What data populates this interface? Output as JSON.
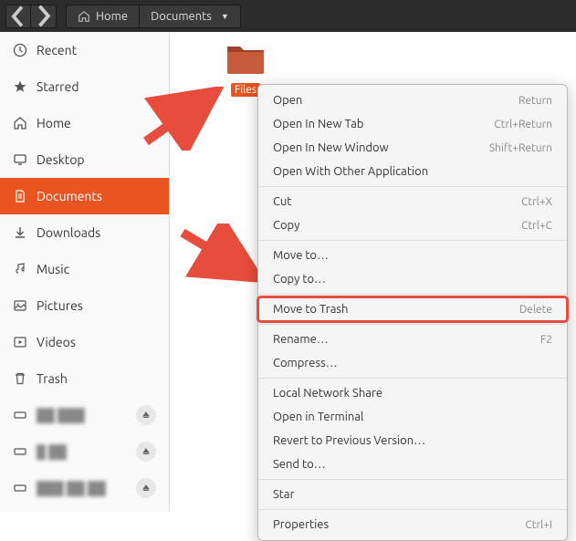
{
  "topbar": {
    "home_label": "Home",
    "current_label": "Documents"
  },
  "sidebar": {
    "items": [
      {
        "icon": "clock",
        "label": "Recent"
      },
      {
        "icon": "star",
        "label": "Starred"
      },
      {
        "icon": "home",
        "label": "Home"
      },
      {
        "icon": "desktop",
        "label": "Desktop"
      },
      {
        "icon": "documents",
        "label": "Documents"
      },
      {
        "icon": "downloads",
        "label": "Downloads"
      },
      {
        "icon": "music",
        "label": "Music"
      },
      {
        "icon": "pictures",
        "label": "Pictures"
      },
      {
        "icon": "videos",
        "label": "Videos"
      },
      {
        "icon": "trash",
        "label": "Trash"
      }
    ]
  },
  "folder": {
    "name": "Files"
  },
  "context_menu": [
    {
      "label": "Open",
      "shortcut": "Return"
    },
    {
      "label": "Open In New Tab",
      "shortcut": "Ctrl+Return"
    },
    {
      "label": "Open In New Window",
      "shortcut": "Shift+Return"
    },
    {
      "label": "Open With Other Application",
      "shortcut": ""
    },
    {
      "sep": true
    },
    {
      "label": "Cut",
      "shortcut": "Ctrl+X"
    },
    {
      "label": "Copy",
      "shortcut": "Ctrl+C"
    },
    {
      "sep": true
    },
    {
      "label": "Move to…",
      "shortcut": ""
    },
    {
      "label": "Copy to…",
      "shortcut": ""
    },
    {
      "sep": true
    },
    {
      "label": "Move to Trash",
      "shortcut": "Delete",
      "highlight": true
    },
    {
      "sep": true
    },
    {
      "label": "Rename…",
      "shortcut": "F2"
    },
    {
      "label": "Compress…",
      "shortcut": ""
    },
    {
      "sep": true
    },
    {
      "label": "Local Network Share",
      "shortcut": ""
    },
    {
      "label": "Open in Terminal",
      "shortcut": ""
    },
    {
      "label": "Revert to Previous Version…",
      "shortcut": ""
    },
    {
      "label": "Send to…",
      "shortcut": ""
    },
    {
      "sep": true
    },
    {
      "label": "Star",
      "shortcut": ""
    },
    {
      "sep": true
    },
    {
      "label": "Properties",
      "shortcut": "Ctrl+I"
    }
  ]
}
